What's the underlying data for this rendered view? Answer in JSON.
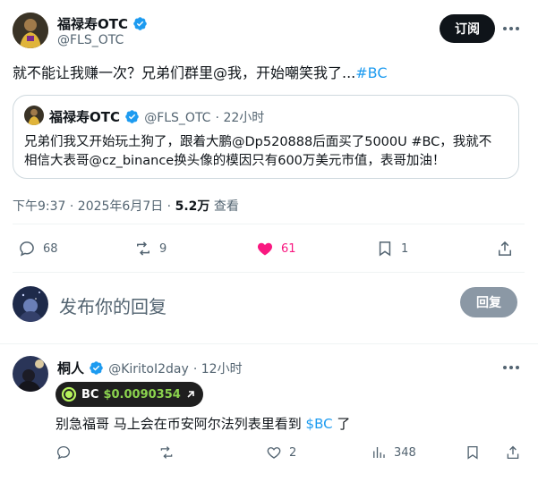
{
  "colors": {
    "accent": "#1d9bf0",
    "like": "#f91880",
    "text": "#0f1419",
    "muted": "#536471",
    "price_green": "#8bd34e"
  },
  "main_post": {
    "author_name": "福禄寿OTC",
    "author_handle": "@FLS_OTC",
    "subscribe_label": "订阅",
    "text_before": "就不能让我赚一次？兄弟们群里@我，开始嘲笑我了...",
    "hashtag": "#BC",
    "quote": {
      "author_name": "福禄寿OTC",
      "author_handle": "@FLS_OTC",
      "time": "· 22小时",
      "line1": "兄弟们我又开始玩土狗了，跟着大鹏@Dp520888后面买了5000U #BC，我就不",
      "line2": "相信大表哥@cz_binance换头像的模因只有600万美元市值，表哥加油！"
    },
    "timestamp": "下午9:37 · 2025年6月7日 ·",
    "views_count": "5.2万",
    "views_label": "查看",
    "replies": "68",
    "reposts": "9",
    "likes": "61",
    "bookmarks": "1"
  },
  "reply_composer": {
    "placeholder": "发布你的回复",
    "button_label": "回复"
  },
  "reply_post": {
    "author_name": "桐人",
    "author_handle": "@KiritoI2day",
    "time": "· 12小时",
    "badge_ticker": "BC",
    "badge_price": "$0.0090354",
    "text_before": "别急福哥 马上会在币安阿尔法列表里看到 ",
    "cashtag": "$BC",
    "text_after": " 了",
    "replies": "",
    "reposts": "",
    "likes": "2",
    "views": "348"
  }
}
